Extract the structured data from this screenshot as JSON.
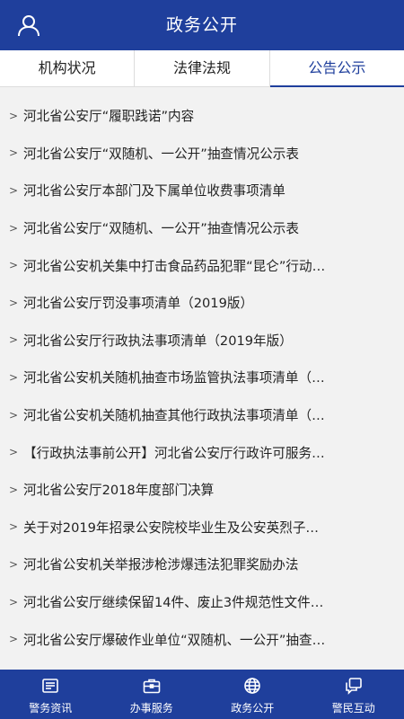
{
  "header": {
    "title": "政务公开",
    "icon": "user-icon"
  },
  "tabs": [
    {
      "label": "机构状况",
      "active": false
    },
    {
      "label": "法律法规",
      "active": false
    },
    {
      "label": "公告公示",
      "active": true
    }
  ],
  "list": {
    "items": [
      "河北省公安厅“履职践诺”内容",
      "河北省公安厅“双随机、一公开”抽查情况公示表",
      "河北省公安厅本部门及下属单位收费事项清单",
      "河北省公安厅“双随机、一公开”抽查情况公示表",
      "河北省公安机关集中打击食品药品犯罪“昆仑”行动…",
      "河北省公安厅罚没事项清单（2019版）",
      "河北省公安厅行政执法事项清单（2019年版）",
      "河北省公安机关随机抽查市场监管执法事项清单（…",
      "河北省公安机关随机抽查其他行政执法事项清单（…",
      "【行政执法事前公开】河北省公安厅行政许可服务…",
      "河北省公安厅2018年度部门决算",
      "关于对2019年招录公安院校毕业生及公安英烈子…",
      "河北省公安机关举报涉枪涉爆违法犯罪奖励办法",
      "河北省公安厅继续保留14件、废止3件规范性文件…",
      "河北省公安厅爆破作业单位“双随机、一公开”抽查…"
    ]
  },
  "bottom_nav": [
    {
      "label": "警务资讯",
      "icon": "news-icon"
    },
    {
      "label": "办事服务",
      "icon": "briefcase-icon"
    },
    {
      "label": "政务公开",
      "icon": "globe-icon"
    },
    {
      "label": "警民互动",
      "icon": "chat-icon"
    }
  ],
  "colors": {
    "primary": "#1f3f9c",
    "background": "#f2f2f2"
  }
}
